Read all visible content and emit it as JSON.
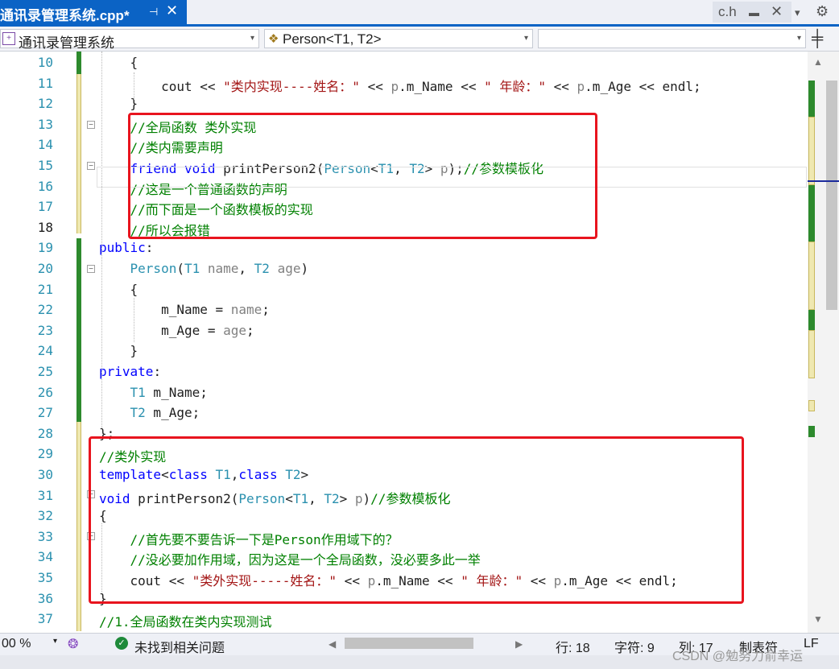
{
  "tabs": {
    "active_title": "通讯录管理系统.cpp*",
    "pin_glyph": "⊣",
    "close_glyph": "✕",
    "other_tab": "c.h",
    "other_pin_glyph": "▬",
    "dropdown_glyph": "▾",
    "settings_glyph": "⚙"
  },
  "navbar": {
    "project": "通讯录管理系统",
    "scope": "Person<T1, T2>",
    "member": "",
    "project_icon": "+",
    "scope_icon": "❖",
    "arrow": "▾",
    "split_glyph": "╪"
  },
  "editor": {
    "line_numbers": [
      "10",
      "11",
      "12",
      "13",
      "14",
      "15",
      "16",
      "17",
      "18",
      "19",
      "20",
      "21",
      "22",
      "23",
      "24",
      "25",
      "26",
      "27",
      "28",
      "29",
      "30",
      "31",
      "32",
      "33",
      "34",
      "35",
      "36",
      "37"
    ],
    "current_line": "18",
    "lines": [
      [
        [
          "    {",
          "id"
        ]
      ],
      [
        [
          "        cout ",
          "id"
        ],
        [
          "<< ",
          "id"
        ],
        [
          "\"类内实现----姓名：\"",
          "st"
        ],
        [
          " << ",
          "id"
        ],
        [
          "p",
          "pa"
        ],
        [
          ".m_Name << ",
          "id"
        ],
        [
          "\" 年龄：\"",
          "st"
        ],
        [
          " << ",
          "id"
        ],
        [
          "p",
          "pa"
        ],
        [
          ".m_Age << endl;",
          "id"
        ]
      ],
      [
        [
          "    }",
          "id"
        ]
      ],
      [
        [
          "    //全局函数 类外实现",
          "cm"
        ]
      ],
      [
        [
          "    //类内需要声明",
          "cm"
        ]
      ],
      [
        [
          "    ",
          "id"
        ],
        [
          "friend",
          "kw"
        ],
        [
          " ",
          "id"
        ],
        [
          "void",
          "kw"
        ],
        [
          " printPerson2(",
          "id"
        ],
        [
          "Person",
          "ty"
        ],
        [
          "<",
          "id"
        ],
        [
          "T1",
          "ty"
        ],
        [
          ", ",
          "id"
        ],
        [
          "T2",
          "ty"
        ],
        [
          "> ",
          "id"
        ],
        [
          "p",
          "pa"
        ],
        [
          ");",
          "id"
        ],
        [
          "//参数模板化",
          "cm"
        ]
      ],
      [
        [
          "    //这是一个普通函数的声明",
          "cm"
        ]
      ],
      [
        [
          "    //而下面是一个函数模板的实现",
          "cm"
        ]
      ],
      [
        [
          "    //所以会报错",
          "cm"
        ]
      ],
      [
        [
          "public",
          "kw"
        ],
        [
          ":",
          "id"
        ]
      ],
      [
        [
          "    ",
          "id"
        ],
        [
          "Person",
          "ty"
        ],
        [
          "(",
          "id"
        ],
        [
          "T1",
          "ty"
        ],
        [
          " ",
          "id"
        ],
        [
          "name",
          "pa"
        ],
        [
          ", ",
          "id"
        ],
        [
          "T2",
          "ty"
        ],
        [
          " ",
          "id"
        ],
        [
          "age",
          "pa"
        ],
        [
          ")",
          "id"
        ]
      ],
      [
        [
          "    {",
          "id"
        ]
      ],
      [
        [
          "        m_Name = ",
          "id"
        ],
        [
          "name",
          "pa"
        ],
        [
          ";",
          "id"
        ]
      ],
      [
        [
          "        m_Age = ",
          "id"
        ],
        [
          "age",
          "pa"
        ],
        [
          ";",
          "id"
        ]
      ],
      [
        [
          "    }",
          "id"
        ]
      ],
      [
        [
          "private",
          "kw"
        ],
        [
          ":",
          "id"
        ]
      ],
      [
        [
          "    ",
          "id"
        ],
        [
          "T1",
          "ty"
        ],
        [
          " m_Name;",
          "id"
        ]
      ],
      [
        [
          "    ",
          "id"
        ],
        [
          "T2",
          "ty"
        ],
        [
          " m_Age;",
          "id"
        ]
      ],
      [
        [
          "};",
          "id"
        ]
      ],
      [
        [
          "//类外实现",
          "cm"
        ]
      ],
      [
        [
          "template",
          "kw"
        ],
        [
          "<",
          "id"
        ],
        [
          "class",
          "kw"
        ],
        [
          " ",
          "id"
        ],
        [
          "T1",
          "ty"
        ],
        [
          ",",
          "id"
        ],
        [
          "class",
          "kw"
        ],
        [
          " ",
          "id"
        ],
        [
          "T2",
          "ty"
        ],
        [
          ">",
          "id"
        ]
      ],
      [
        [
          "void",
          "kw"
        ],
        [
          " printPerson2(",
          "id"
        ],
        [
          "Person",
          "ty"
        ],
        [
          "<",
          "id"
        ],
        [
          "T1",
          "ty"
        ],
        [
          ", ",
          "id"
        ],
        [
          "T2",
          "ty"
        ],
        [
          "> ",
          "id"
        ],
        [
          "p",
          "pa"
        ],
        [
          ")",
          "id"
        ],
        [
          "//参数模板化",
          "cm"
        ]
      ],
      [
        [
          "{",
          "id"
        ]
      ],
      [
        [
          "    //首先要不要告诉一下是Person作用域下的？",
          "cm"
        ]
      ],
      [
        [
          "    //没必要加作用域，因为这是一个全局函数，没必要多此一举",
          "cm"
        ]
      ],
      [
        [
          "    cout ",
          "id"
        ],
        [
          "<< ",
          "id"
        ],
        [
          "\"类外实现-----姓名：\"",
          "st"
        ],
        [
          " << ",
          "id"
        ],
        [
          "p",
          "pa"
        ],
        [
          ".m_Name << ",
          "id"
        ],
        [
          "\" 年龄：\"",
          "st"
        ],
        [
          " << ",
          "id"
        ],
        [
          "p",
          "pa"
        ],
        [
          ".m_Age << endl;",
          "id"
        ]
      ],
      [
        [
          "}",
          "id"
        ]
      ],
      [
        [
          "//1.全局函数在类内实现测试",
          "cm"
        ]
      ]
    ]
  },
  "statusbar": {
    "zoom": "00 %",
    "zoom_arrow": "▾",
    "issues": "未找到相关问题",
    "ok_glyph": "✓",
    "line": "行: 18",
    "char": "字符: 9",
    "col": "列: 17",
    "tabs": "制表符",
    "eol": "LF",
    "scroll_left": "◀",
    "scroll_right": "▶"
  },
  "scrollbar": {
    "up": "▲",
    "down": "▼"
  },
  "watermark": "CSDN @勉努力俞幸运"
}
